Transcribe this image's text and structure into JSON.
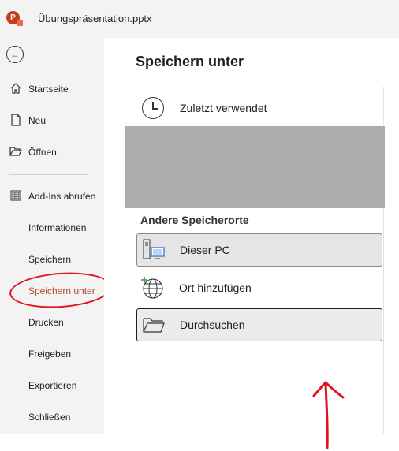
{
  "app": {
    "logo_letter": "P",
    "document_title": "Übungspräsentation.pptx"
  },
  "sidebar": {
    "back_icon": "back-arrow-icon",
    "items": [
      {
        "label": "Startseite",
        "icon": "home-icon"
      },
      {
        "label": "Neu",
        "icon": "new-document-icon"
      },
      {
        "label": "Öffnen",
        "icon": "open-folder-icon"
      },
      {
        "label": "Add-Ins abrufen",
        "icon": "grid-icon"
      },
      {
        "label": "Informationen"
      },
      {
        "label": "Speichern"
      },
      {
        "label": "Speichern unter",
        "active": true
      },
      {
        "label": "Drucken"
      },
      {
        "label": "Freigeben"
      },
      {
        "label": "Exportieren"
      },
      {
        "label": "Schließen"
      }
    ]
  },
  "main": {
    "title": "Speichern unter",
    "recent_label": "Zuletzt verwendet",
    "other_locations_label": "Andere Speicherorte",
    "options": [
      {
        "label": "Dieser PC",
        "icon": "pc-icon"
      },
      {
        "label": "Ort hinzufügen",
        "icon": "globe-add-icon"
      },
      {
        "label": "Durchsuchen",
        "icon": "folder-icon"
      }
    ]
  },
  "colors": {
    "accent": "#b7472a",
    "annotation": "#e0141e",
    "sidebar_bg": "#f3f3f3",
    "placeholder_gray": "#acacae"
  }
}
